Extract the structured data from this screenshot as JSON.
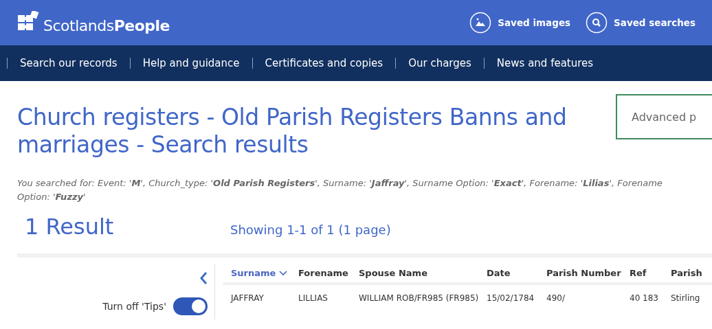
{
  "header": {
    "logo": {
      "light": "Scotlands",
      "bold": "People"
    },
    "links": [
      {
        "kind": "images",
        "label": "Saved images"
      },
      {
        "kind": "search",
        "label": "Saved searches"
      }
    ]
  },
  "nav": [
    "Search our records",
    "Help and guidance",
    "Certificates and copies",
    "Our charges",
    "News and features"
  ],
  "title": "Church registers - Old Parish Registers Banns and marriages - Search results",
  "advanced_button": "Advanced p",
  "search_summary": "You searched for: Event: '**M**', Church_type: '**Old Parish Registers**', Surname: '**Jaffray**', Surname Option: '**Exact**', Forename: '**Lilias**', Forename Option: '**Fuzzy**'",
  "result_count": "1 Result",
  "showing": "Showing 1-1 of 1 (1 page)",
  "tips_toggle": {
    "label": "Turn off 'Tips'",
    "on": true
  },
  "table": {
    "columns": [
      {
        "label": "Surname",
        "sorted": true
      },
      {
        "label": "Forename",
        "sorted": false
      },
      {
        "label": "Spouse Name",
        "sorted": false
      },
      {
        "label": "Date",
        "sorted": false
      },
      {
        "label": "Parish Number",
        "sorted": false
      },
      {
        "label": "Ref",
        "sorted": false
      },
      {
        "label": "Parish",
        "sorted": false
      }
    ],
    "rows": [
      [
        "JAFFRAY",
        "LILLIAS",
        "WILLIAM ROB/FR985 (FR985)",
        "15/02/1784",
        "490/",
        "40 183",
        "Stirling"
      ]
    ]
  }
}
